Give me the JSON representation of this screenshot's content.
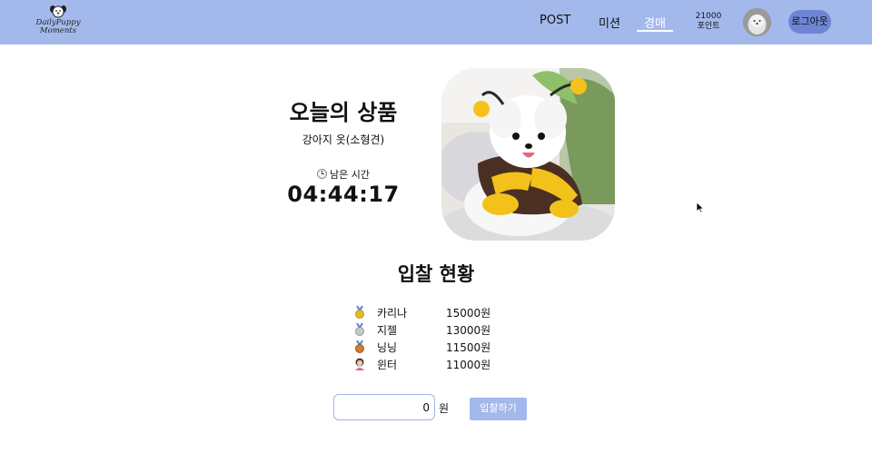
{
  "app": {
    "logo_line1": "DailyPuppy",
    "logo_line2": "Moments"
  },
  "nav": {
    "post": "POST",
    "mission": "미션",
    "auction": "경매"
  },
  "user": {
    "points_value": "21000",
    "points_label": "포인트",
    "logout_label": "로그아웃"
  },
  "product": {
    "heading": "오늘의 상품",
    "name": "강아지 옷(소형견)",
    "remaining_label": "남은 시간",
    "timer": "04:44:17",
    "image_icon": "puppy-in-bee-costume"
  },
  "bids": {
    "heading": "입찰 현황",
    "entries": [
      {
        "rank_icon": "gold-medal-icon",
        "name": "카리나",
        "amount": "15000원"
      },
      {
        "rank_icon": "silver-medal-icon",
        "name": "지젤",
        "amount": "13000원"
      },
      {
        "rank_icon": "bronze-medal-icon",
        "name": "닝닝",
        "amount": "11500원"
      },
      {
        "rank_icon": "person-icon",
        "name": "윈터",
        "amount": "11000원"
      }
    ]
  },
  "bid_form": {
    "value": "0",
    "unit": "원",
    "button_label": "입찰하기"
  },
  "colors": {
    "header": "#a3b9eb",
    "logout_bg": "#6e85d4",
    "button_bg": "#a3b9eb"
  }
}
